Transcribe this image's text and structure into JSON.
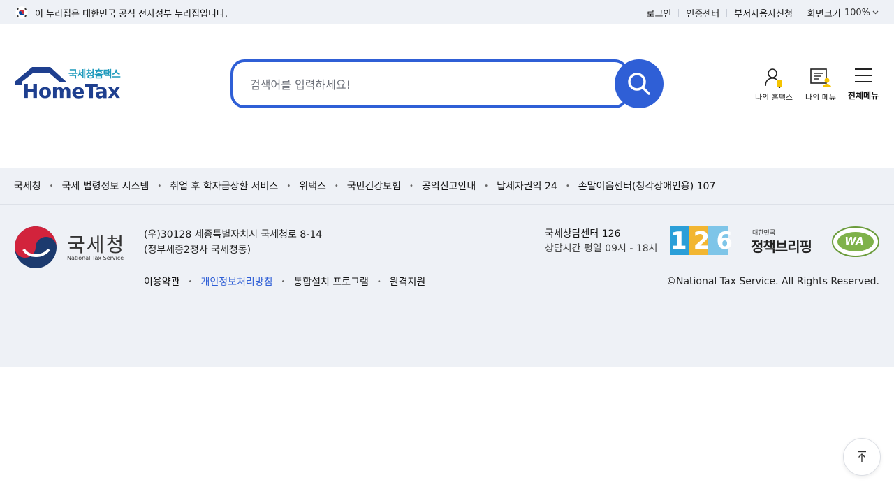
{
  "gov_bar": {
    "notice": "이 누리집은 대한민국 공식 전자정부 누리집입니다.",
    "links": {
      "login": "로그인",
      "cert": "인증센터",
      "dept": "부서사용자신청",
      "zoom_label": "화면크기",
      "zoom_value": "100%"
    }
  },
  "header": {
    "logo_sub": "국세청홈택스",
    "logo_main": "HomeTax",
    "search_placeholder": "검색어를 입력하세요!",
    "icons": {
      "my_hometax": "나의 홈택스",
      "my_menu": "나의 메뉴",
      "all_menu": "전체메뉴"
    }
  },
  "footer": {
    "related_sites": [
      "국세청",
      "국세 법령정보 시스템",
      "취업 후 학자금상환 서비스",
      "위택스",
      "국민건강보험",
      "공익신고안내",
      "납세자권익 24",
      "손말이음센터(청각장애인용) 107"
    ],
    "nts_logo_ko": "국세청",
    "nts_logo_en": "National Tax Service",
    "address_line1": "(우)30128 세종특별자치시 국세청로 8-14",
    "address_line2": "(정부세종2청사 국세청동)",
    "links": {
      "terms": "이용약관",
      "privacy": "개인정보처리방침",
      "install": "통합설치 프로그램",
      "remote": "원격지원"
    },
    "call_center": "국세상담센터 126",
    "call_hours": "상담시간 평일 09시 - 18시",
    "badge_126": "126",
    "briefing_small": "대한민국",
    "briefing_main": "정책브리핑",
    "wa_text": "WA",
    "copyright": "©National Tax Service. All Rights Reserved."
  },
  "colors": {
    "brand_blue": "#2f5fd6",
    "logo_navy": "#1e3f8f",
    "footer_bg": "#eef1f6"
  }
}
